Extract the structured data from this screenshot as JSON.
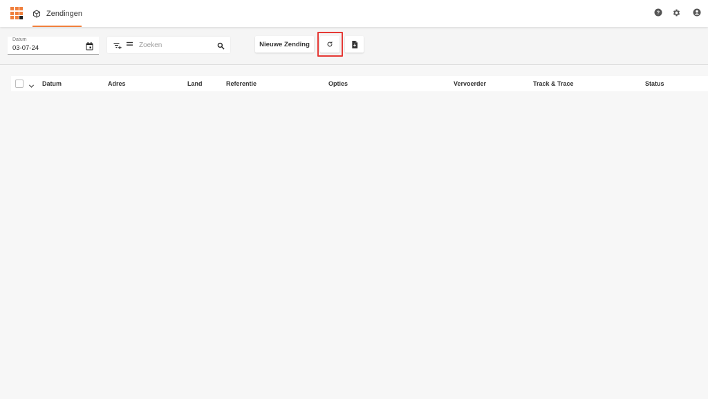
{
  "colors": {
    "accent": "#f07f3c",
    "grid_dark": "#212121",
    "highlight": "#e53935"
  },
  "app": {
    "grid_icon": "apps-grid-icon",
    "tab": {
      "label": "Zendingen",
      "icon": "package-icon"
    }
  },
  "header_icons": [
    "help-icon",
    "settings-icon",
    "account-icon"
  ],
  "toolbar": {
    "date": {
      "label": "Datum",
      "value": "03-07-24",
      "icon": "calendar-icon"
    },
    "search": {
      "placeholder": "Zoeken",
      "value": ""
    },
    "new_button_label": "Nieuwe Zending",
    "refresh_icon": "refresh-icon",
    "export_icon": "file-export-icon"
  },
  "table": {
    "columns": [
      "Datum",
      "Adres",
      "Land",
      "Referentie",
      "Opties",
      "Vervoerder",
      "Track & Trace",
      "Status"
    ],
    "rows": []
  }
}
